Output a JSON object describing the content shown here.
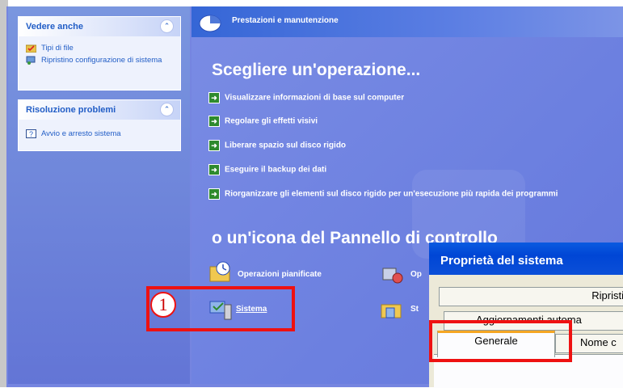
{
  "sidebar": {
    "see_also": {
      "title": "Vedere anche",
      "items": [
        "Tipi di file",
        "Ripristino configurazione di sistema"
      ]
    },
    "troubleshoot": {
      "title": "Risoluzione problemi",
      "items": [
        "Avvio e arresto sistema"
      ]
    }
  },
  "header": {
    "title": "Prestazioni e manutenzione"
  },
  "main": {
    "pick_task": "Scegliere un'operazione...",
    "tasks": [
      "Visualizzare informazioni di base sul computer",
      "Regolare gli effetti visivi",
      "Liberare spazio sul disco rigido",
      "Eseguire il backup dei dati",
      "Riorganizzare gli elementi sul disco rigido per un'esecuzione più rapida dei programmi"
    ],
    "or_icon": "o un'icona del Pannello di controllo",
    "cp_items": {
      "scheduled": "Operazioni pianificate",
      "system": "Sistema",
      "op_partial": "Op",
      "st_partial": "St"
    }
  },
  "dialog": {
    "title": "Proprietà del sistema",
    "tabs": {
      "restore": "Ripristi",
      "updates": "Aggiornamenti automa",
      "general": "Generale",
      "computer_name": "Nome c"
    }
  },
  "callout": {
    "number": "1"
  },
  "colors": {
    "callout": "#ee1111",
    "pane": "#6c80e0",
    "title_bar": "#0046d5"
  }
}
